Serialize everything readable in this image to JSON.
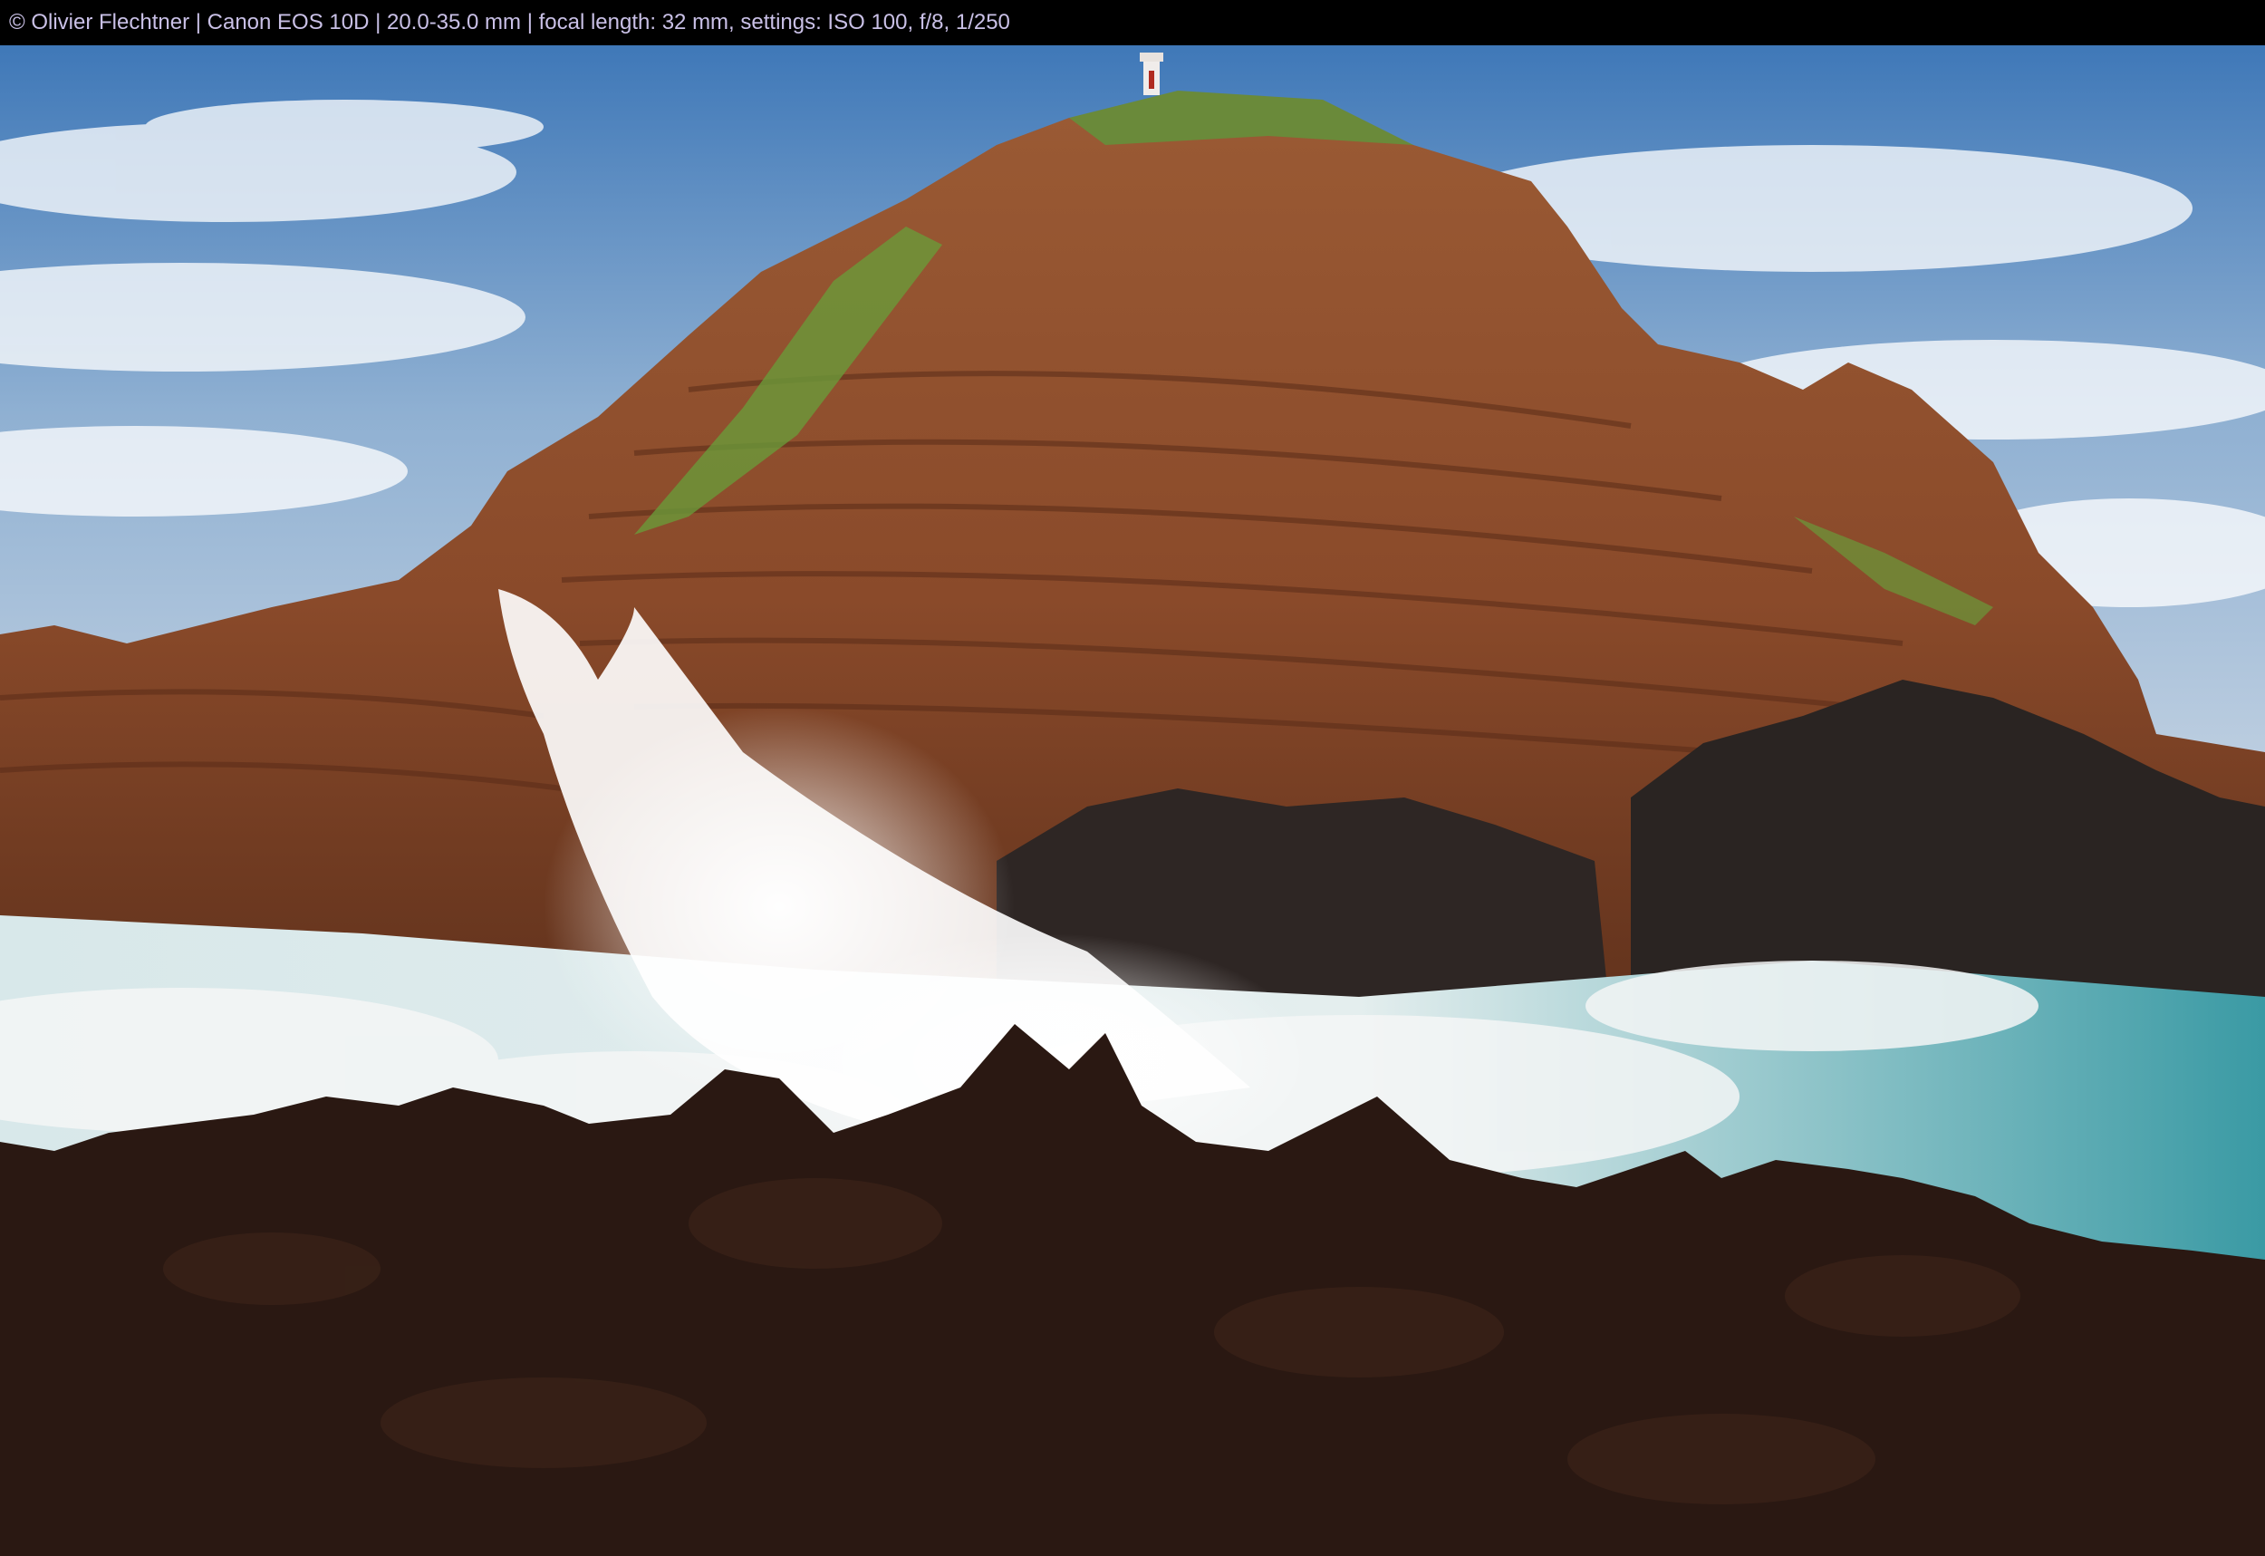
{
  "caption": "© Olivier Flechtner | Canon EOS 10D | 20.0-35.0 mm | focal length: 32 mm, settings: ISO 100, f/8, 1/250",
  "photo": {
    "subject": "coastal-cliff-with-crashing-wave",
    "colors": {
      "sky_top": "#3f78b8",
      "sky_bottom": "#c9d6e4",
      "cliff": "#8a4a2a",
      "cliff_dark": "#4a2818",
      "grass": "#6a8a3a",
      "sea": "#3a9aa4",
      "foam": "#f2f4f4",
      "lava": "#2a1812"
    }
  }
}
